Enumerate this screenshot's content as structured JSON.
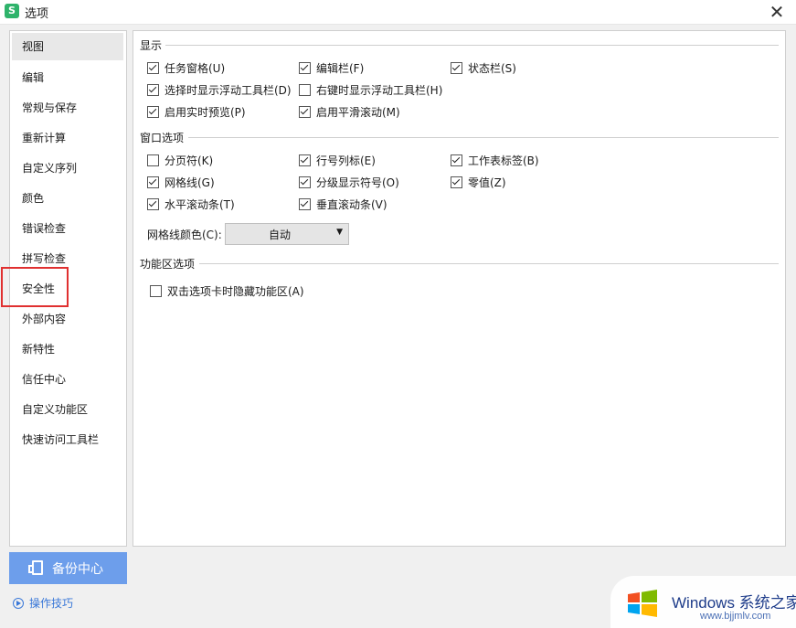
{
  "window": {
    "title": "选项",
    "app_icon_letter": "S",
    "close_glyph": "✕"
  },
  "nav": {
    "items": [
      {
        "label": "视图",
        "active": true
      },
      {
        "label": "编辑"
      },
      {
        "label": "常规与保存"
      },
      {
        "label": "重新计算"
      },
      {
        "label": "自定义序列"
      },
      {
        "label": "颜色"
      },
      {
        "label": "错误检查"
      },
      {
        "label": "拼写检查"
      },
      {
        "label": "安全性",
        "highlighted": true
      },
      {
        "label": "外部内容"
      },
      {
        "label": "新特性"
      },
      {
        "label": "信任中心"
      },
      {
        "label": "自定义功能区"
      },
      {
        "label": "快速访问工具栏"
      }
    ],
    "highlight_color": "#e03030"
  },
  "sections": {
    "display": {
      "title": "显示",
      "options": [
        {
          "label": "任务窗格(U)",
          "checked": true
        },
        {
          "label": "编辑栏(F)",
          "checked": true
        },
        {
          "label": "状态栏(S)",
          "checked": true
        },
        {
          "label": "选择时显示浮动工具栏(D)",
          "checked": true
        },
        {
          "label": "右键时显示浮动工具栏(H)",
          "checked": false
        },
        {
          "label": "启用实时预览(P)",
          "checked": true
        },
        {
          "label": "启用平滑滚动(M)",
          "checked": true
        }
      ]
    },
    "window_options": {
      "title": "窗口选项",
      "options": [
        {
          "label": "分页符(K)",
          "checked": false
        },
        {
          "label": "行号列标(E)",
          "checked": true
        },
        {
          "label": "工作表标签(B)",
          "checked": true
        },
        {
          "label": "网格线(G)",
          "checked": true
        },
        {
          "label": "分级显示符号(O)",
          "checked": true
        },
        {
          "label": "零值(Z)",
          "checked": true
        },
        {
          "label": "水平滚动条(T)",
          "checked": true
        },
        {
          "label": "垂直滚动条(V)",
          "checked": true
        }
      ],
      "gridline_color_label": "网格线颜色(C):",
      "gridline_color_value": "自动"
    },
    "ribbon": {
      "title": "功能区选项",
      "options": [
        {
          "label": "双击选项卡时隐藏功能区(A)",
          "checked": false
        }
      ]
    }
  },
  "footer": {
    "backup_label": "备份中心",
    "tips_label": "操作技巧"
  },
  "watermark": {
    "title": "Windows 系统之家",
    "url": "www.bjjmlv.com"
  },
  "colors": {
    "accent": "#6d9eeb",
    "link": "#3a78d8"
  }
}
